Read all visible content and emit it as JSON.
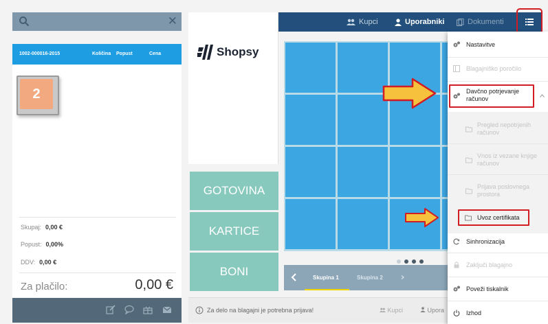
{
  "header": {
    "search": {
      "placeholder": "",
      "clear_glyph": "✕"
    },
    "nav": {
      "customers": "Kupci",
      "users": "Uporabniki",
      "documents": "Dokumenti"
    },
    "menu_icon": "list-icon"
  },
  "receipt": {
    "doc_number": "1002-000016-2015",
    "col_quantity": "Količina",
    "col_discount": "Popust",
    "col_price": "Cena",
    "step_badge": "2",
    "subtotal_label": "Skupaj:",
    "subtotal_value": "0,00 €",
    "discount_label": "Popust:",
    "discount_value": "0,00%",
    "vat_label": "DDV:",
    "vat_value": "0,00 €",
    "pay_label": "Za plačilo:",
    "pay_value": "0,00 €"
  },
  "brand": {
    "name": "Shopsy"
  },
  "payment": {
    "cash": "GOTOVINA",
    "cards": "KARTICE",
    "vouchers": "BONI"
  },
  "groups": {
    "items": [
      "Skupina 1",
      "Skupina 2"
    ],
    "active_index": 0
  },
  "status": {
    "message": "Za delo na blagajni je potrebna prijava!",
    "customers": "Kupci",
    "users_truncated": "Upora"
  },
  "menu": {
    "settings": "Nastavitve",
    "cash_report": "Blagajniško poročilo",
    "fiscal_line1": "Davčno potrjevanje",
    "fiscal_line2": "računov",
    "unconfirmed_line1": "Pregled nepotrjenih",
    "unconfirmed_line2": "računov",
    "bound_line1": "Vnos iz vezane knjige",
    "bound_line2": "računov",
    "premises_line1": "Prijava poslovnega",
    "premises_line2": "prostora",
    "import_cert": "Uvoz certifikata",
    "sync": "Sinhronizacija",
    "close_register": "Zaključi blagajno",
    "connect_printer": "Poveži tiskalnik",
    "exit": "Izhod"
  },
  "colors": {
    "nav_bg": "#224f7b",
    "receipt_header": "#1e9de3",
    "tile": "#3ca6e2",
    "pay_button": "#87c9bd",
    "highlight": "#d01c22",
    "arrow_fill": "#f6c23e"
  }
}
